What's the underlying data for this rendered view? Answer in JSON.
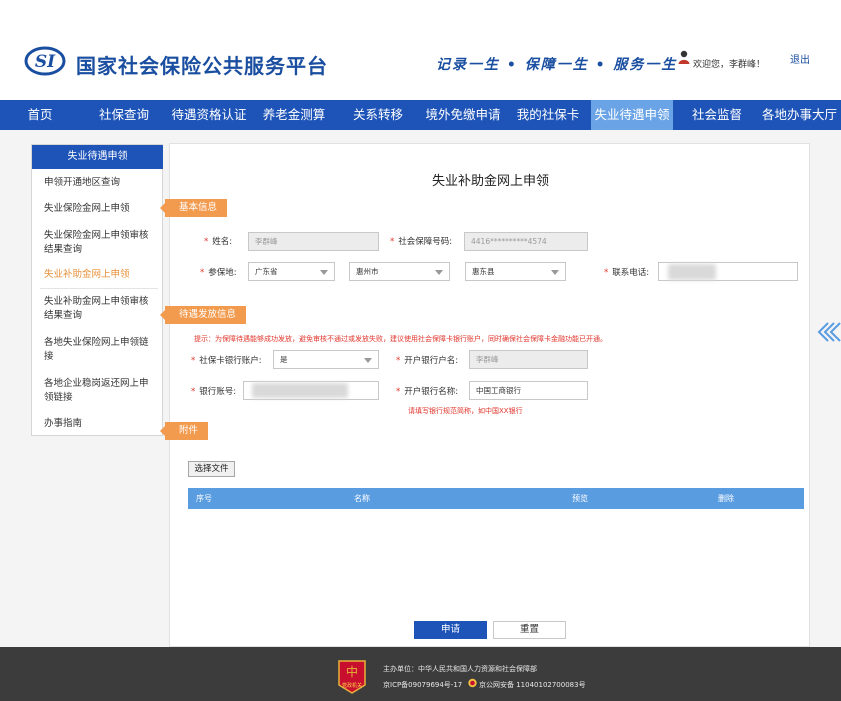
{
  "header": {
    "logo_mark": "SI",
    "site_title": "国家社会保险公共服务平台",
    "slogan": "记录一生 • 保障一生 • 服务一生",
    "welcome": "欢迎您，李群峰！",
    "logout": "退出"
  },
  "nav": {
    "items": [
      {
        "label": "首页"
      },
      {
        "label": "社保查询"
      },
      {
        "label": "待遇资格认证"
      },
      {
        "label": "养老金测算"
      },
      {
        "label": "关系转移"
      },
      {
        "label": "境外免缴申请"
      },
      {
        "label": "我的社保卡"
      },
      {
        "label": "失业待遇申领"
      },
      {
        "label": "社会监督"
      },
      {
        "label": "各地办事大厅"
      }
    ],
    "active": "失业待遇申领"
  },
  "sidebar": {
    "title": "失业待遇申领",
    "items": [
      {
        "label": "申领开通地区查询"
      },
      {
        "label": "失业保险金网上申领"
      },
      {
        "label": "失业保险金网上申领审核结果查询"
      },
      {
        "label": "失业补助金网上申领"
      },
      {
        "label": "失业补助金网上申领审核结果查询"
      },
      {
        "label": "各地失业保险网上申领链接"
      },
      {
        "label": "各地企业稳岗返还网上申领链接"
      },
      {
        "label": "办事指南"
      }
    ],
    "active": "失业补助金网上申领"
  },
  "main": {
    "title": "失业补助金网上申领",
    "sections": {
      "basic": "基本信息",
      "payment": "待遇发放信息",
      "attachment": "附件"
    },
    "basic": {
      "name_label": "姓名:",
      "name_value": "李群峰",
      "ssn_label": "社会保障号码:",
      "ssn_value": "4416**********4574",
      "insured_place_label": "参保地:",
      "province": "广东省",
      "city": "惠州市",
      "county": "惠东县",
      "phone_label": "联系电话:"
    },
    "payment": {
      "tip": "提示：为保障待遇能够成功发放，避免审核不通过或发放失败，建议使用社会保障卡银行账户，同时确保社会保障卡金融功能已开通。",
      "sscard_account_label": "社保卡银行账户:",
      "sscard_account_value": "是",
      "account_holder_label": "开户银行户名:",
      "account_holder_value": "李群峰",
      "bank_account_label": "银行账号:",
      "bank_name_label": "开户银行名称:",
      "bank_name_value": "中国工商银行",
      "bank_name_hint": "请填写银行规范简称，如中国XX银行"
    },
    "attachment": {
      "choose_file": "选择文件",
      "columns": [
        "序号",
        "名称",
        "预览",
        "删除"
      ]
    },
    "buttons": {
      "apply": "申请",
      "reset": "重置"
    },
    "collapse_icon": "double-chevron-left-icon"
  },
  "footer": {
    "host": "主办单位：中华人民共和国人力资源和社会保障部",
    "icp": "京ICP备09079694号-17",
    "police": "京公网安备 11040102700083号",
    "badge_text": "党政机关"
  },
  "colors": {
    "brand_blue": "#1e54b8",
    "nav_active": "#6aa4e6",
    "section_orange": "#f29a4d",
    "active_sidebar_text": "#e8913a",
    "required_red": "#e0352b"
  }
}
